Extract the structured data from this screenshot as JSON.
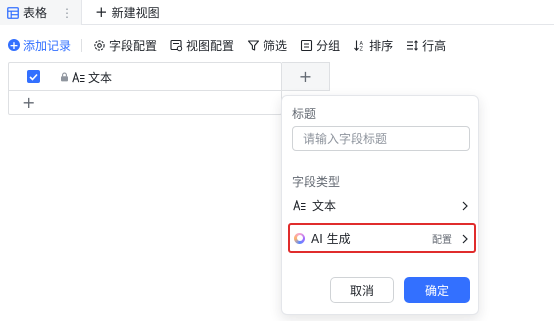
{
  "view_tabs": {
    "active_label": "表格",
    "more_symbol": "⋮",
    "new_view_label": "新建视图"
  },
  "toolbar": {
    "add_record": "添加记录",
    "field_config": "字段配置",
    "view_config": "视图配置",
    "filter": "筛选",
    "group": "分组",
    "sort": "排序",
    "row_height": "行高"
  },
  "grid": {
    "columns": [
      {
        "label": "文本",
        "locked": true,
        "type_icon": "text-type-icon"
      }
    ],
    "add_row_symbol": "+",
    "add_column_symbol": "+"
  },
  "field_popup": {
    "title_label": "标题",
    "title_placeholder": "请输入字段标题",
    "title_value": "",
    "type_label": "字段类型",
    "options": [
      {
        "label": "文本",
        "icon": "text-type-icon"
      },
      {
        "label": "AI 生成",
        "icon": "ai-icon",
        "config_label": "配置",
        "highlighted": true
      }
    ],
    "cancel_label": "取消",
    "confirm_label": "确定"
  },
  "colors": {
    "accent": "#3370ff",
    "highlight_border": "#e02c2c",
    "text_primary": "#1f2329",
    "text_secondary": "#646a73"
  }
}
